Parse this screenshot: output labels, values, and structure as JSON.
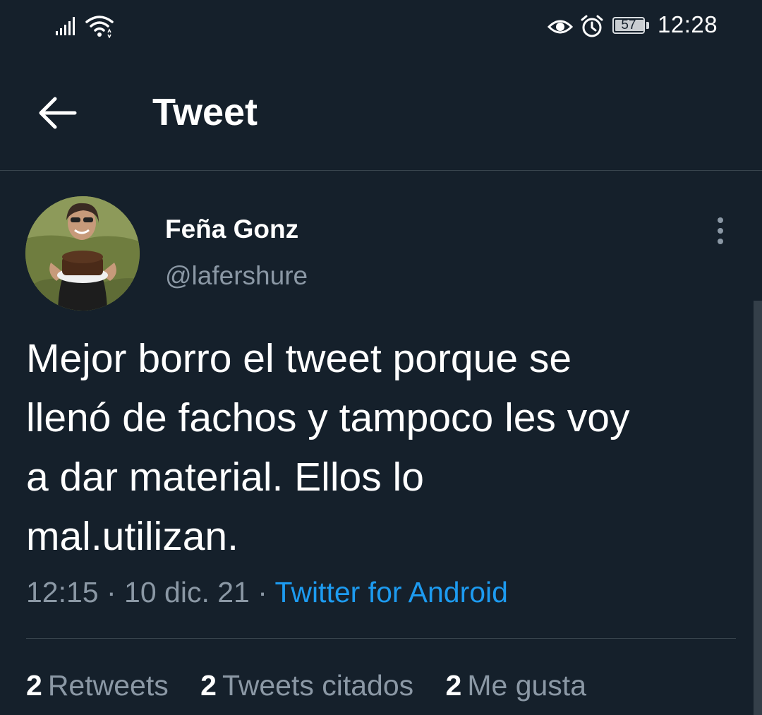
{
  "status_bar": {
    "time": "12:28",
    "battery_level": "57",
    "icons": [
      "signal-icon",
      "wifi-icon",
      "eye-icon",
      "alarm-icon",
      "battery-icon"
    ]
  },
  "header": {
    "title": "Tweet",
    "back_icon": "arrow-left-icon"
  },
  "tweet": {
    "author": {
      "display_name": "Feña Gonz",
      "username": "@lafershure"
    },
    "text": "Mejor borro el tweet porque se\nllenó de fachos y tampoco les voy\na dar material. Ellos lo\nmal.utilizan.",
    "time": "12:15",
    "separator": " · ",
    "date": "10 dic. 21",
    "source": "Twitter for Android",
    "stats": [
      {
        "count": "2",
        "label": "Retweets"
      },
      {
        "count": "2",
        "label": "Tweets citados"
      },
      {
        "count": "2",
        "label": "Me gusta"
      }
    ]
  },
  "colors": {
    "background": "#15202b",
    "text_primary": "#ffffff",
    "text_secondary": "#8b98a5",
    "accent": "#1d9bf0",
    "divider": "#38444d"
  }
}
